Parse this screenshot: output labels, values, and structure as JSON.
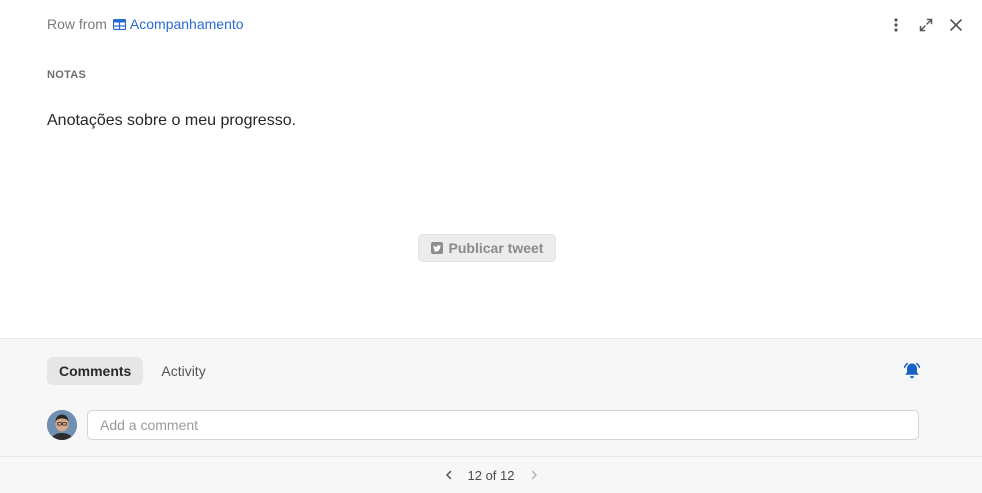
{
  "header": {
    "row_from_label": "Row from",
    "table_name": "Acompanhamento",
    "table_icon": "table-icon",
    "actions": [
      "more-vertical-icon",
      "expand-icon",
      "close-icon"
    ]
  },
  "field": {
    "label": "NOTAS",
    "value": "Anotações sobre o meu progresso."
  },
  "tweet_button": {
    "label": "Publicar tweet",
    "icon": "twitter-icon"
  },
  "comments": {
    "tabs": [
      {
        "label": "Comments",
        "active": true
      },
      {
        "label": "Activity",
        "active": false
      }
    ],
    "placeholder": "Add a comment",
    "bell_icon": "bell-icon",
    "bell_color": "#1a62c7"
  },
  "pager": {
    "text": "12 of 12"
  },
  "colors": {
    "link": "#2a6ad3",
    "accent": "#1a62c7"
  }
}
